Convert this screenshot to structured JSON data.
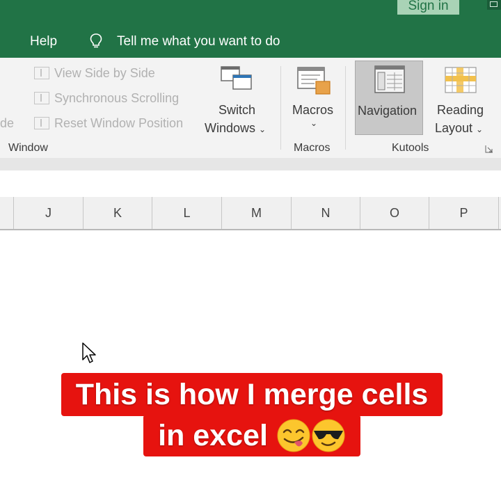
{
  "titlebar": {
    "sign_in": "Sign in"
  },
  "menubar": {
    "help": "Help",
    "tell_me": "Tell me what you want to do"
  },
  "ribbon": {
    "window_group": {
      "cut_label": "de",
      "view_side_by_side": "View Side by Side",
      "synchronous_scrolling": "Synchronous Scrolling",
      "reset_window_position": "Reset Window Position",
      "switch_windows_line1": "Switch",
      "switch_windows_line2": "Windows",
      "group_label": "Window"
    },
    "macros_group": {
      "macros_line1": "Macros",
      "group_label": "Macros"
    },
    "kutools_group": {
      "navigation": "Navigation",
      "reading_line1": "Reading",
      "reading_line2": "Layout",
      "group_label": "Kutools"
    }
  },
  "columns": [
    "J",
    "K",
    "L",
    "M",
    "N",
    "O",
    "P"
  ],
  "caption": {
    "line1": "This is how I merge cells",
    "line2": "in excel"
  },
  "colors": {
    "excel_green": "#217346",
    "caption_red": "#e6130f",
    "ribbon_bg": "#f3f3f3"
  },
  "icons": [
    "lightbulb-icon",
    "view-side-by-side-icon",
    "sync-scroll-icon",
    "reset-window-icon",
    "switch-windows-icon",
    "macros-icon",
    "navigation-icon",
    "reading-layout-icon",
    "dialog-launcher-icon",
    "mouse-cursor-icon",
    "yum-face-emoji",
    "sunglasses-face-emoji"
  ]
}
